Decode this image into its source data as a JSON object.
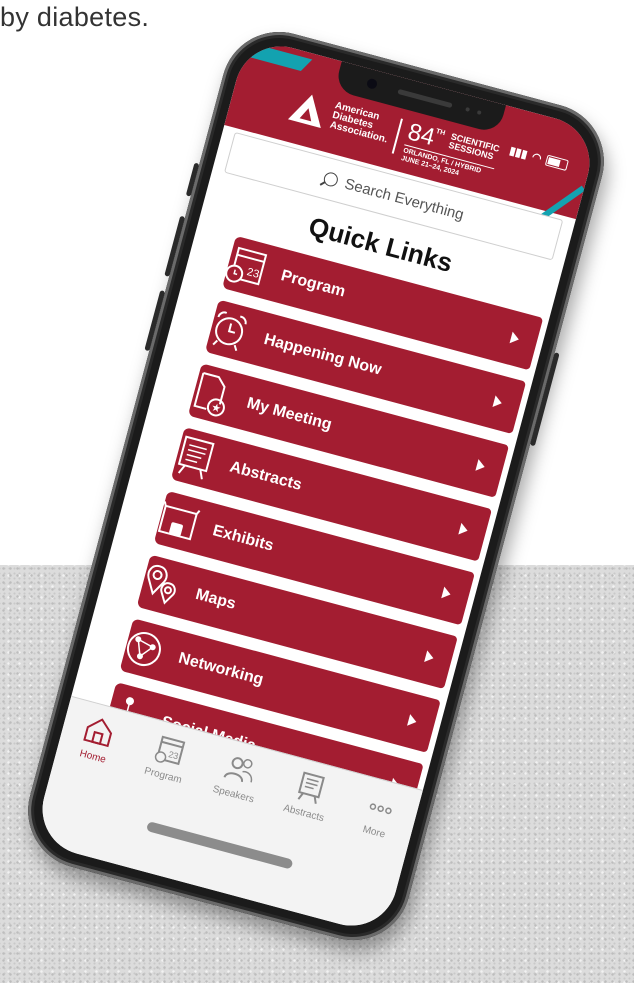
{
  "tagline": "by diabetes.",
  "header": {
    "org_name_1": "American",
    "org_name_2": "Diabetes",
    "org_name_3": "Association.",
    "event_number": "84",
    "event_superscript": "TH",
    "event_title_1": "SCIENTIFIC",
    "event_title_2": "SESSIONS",
    "event_location": "ORLANDO, FL / HYBRID",
    "event_dates": "JUNE 21–24, 2024"
  },
  "search": {
    "placeholder": "Search Everything"
  },
  "quick_links": {
    "title": "Quick Links",
    "items": [
      {
        "label": "Program",
        "icon": "calendar-clock-icon"
      },
      {
        "label": "Happening Now",
        "icon": "alarm-clock-icon"
      },
      {
        "label": "My Meeting",
        "icon": "document-star-icon"
      },
      {
        "label": "Abstracts",
        "icon": "presentation-board-icon"
      },
      {
        "label": "Exhibits",
        "icon": "exhibit-booth-icon"
      },
      {
        "label": "Maps",
        "icon": "map-pin-icon"
      },
      {
        "label": "Networking",
        "icon": "network-globe-icon"
      },
      {
        "label": "Social Media",
        "icon": "social-share-icon"
      }
    ]
  },
  "tabbar": {
    "items": [
      {
        "label": "Home",
        "icon": "home-icon",
        "active": true
      },
      {
        "label": "Program",
        "icon": "calendar-icon"
      },
      {
        "label": "Speakers",
        "icon": "speakers-icon"
      },
      {
        "label": "Abstracts",
        "icon": "abstracts-icon"
      },
      {
        "label": "More",
        "icon": "more-dots-icon"
      }
    ]
  },
  "calendar_day": "23",
  "colors": {
    "brand_red": "#a31d31",
    "teal_accent": "#13a2b0"
  }
}
